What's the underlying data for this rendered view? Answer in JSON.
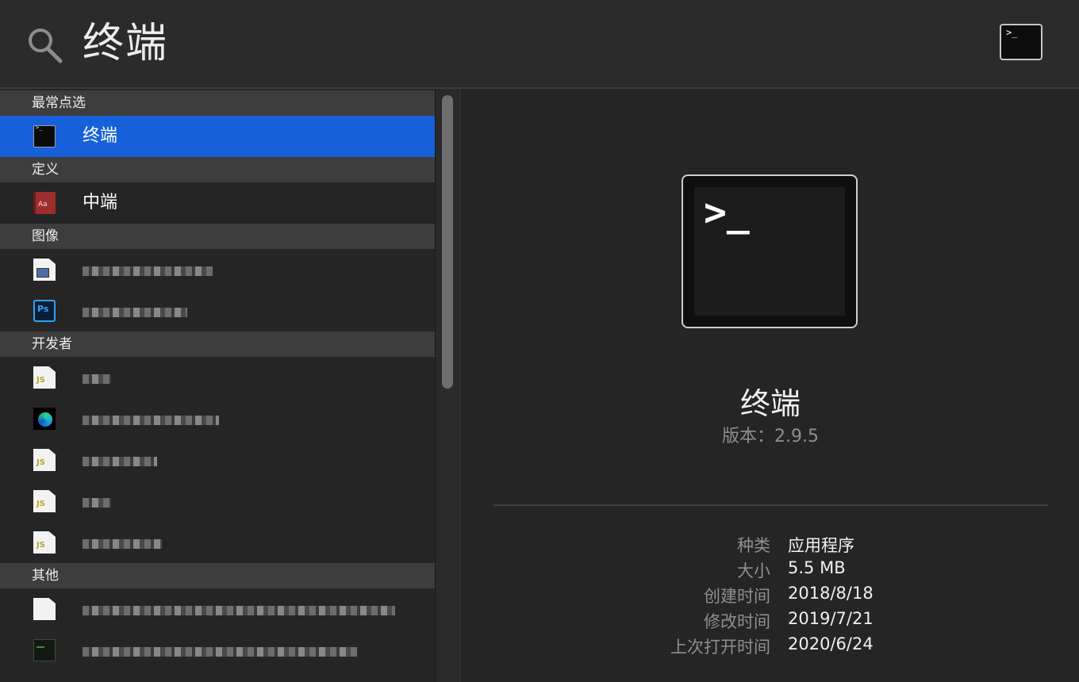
{
  "search": {
    "query": "终端"
  },
  "results": {
    "sections": [
      {
        "title": "最常点选"
      },
      {
        "title": "定义"
      },
      {
        "title": "图像"
      },
      {
        "title": "开发者"
      },
      {
        "title": "其他"
      }
    ],
    "top_hit": {
      "label": "终端",
      "icon": "terminal-icon"
    },
    "definition": {
      "label": "中端",
      "icon": "dictionary-icon"
    }
  },
  "preview": {
    "app_name": "终端",
    "version": "版本：2.9.5",
    "details": [
      {
        "key": "种类",
        "value": "应用程序"
      },
      {
        "key": "大小",
        "value": "5.5 MB"
      },
      {
        "key": "创建时间",
        "value": "2018/8/18"
      },
      {
        "key": "修改时间",
        "value": "2019/7/21"
      },
      {
        "key": "上次打开时间",
        "value": "2020/6/24"
      }
    ]
  },
  "colors": {
    "selection": "#1660d9",
    "background": "#252525",
    "section_header": "#3d3d3d"
  }
}
